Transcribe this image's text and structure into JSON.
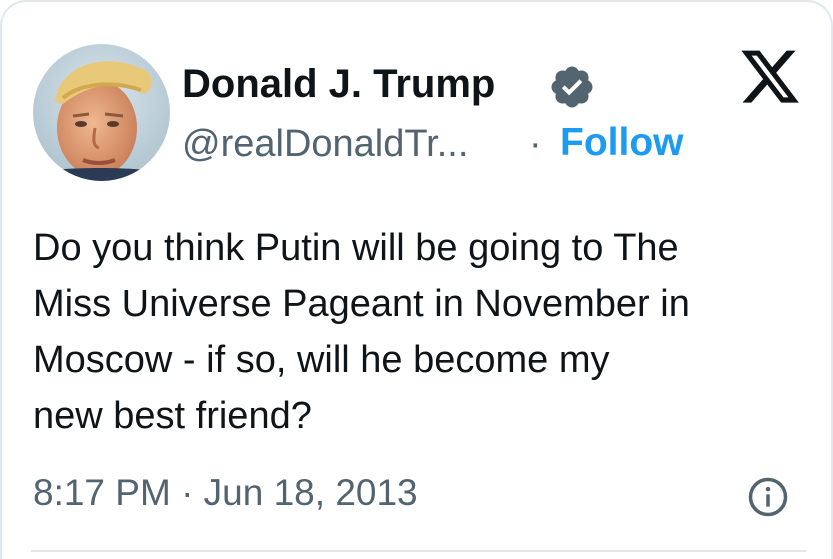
{
  "author": {
    "display_name": "Donald J. Trump",
    "handle": "@realDonaldTr...",
    "verified_icon": "verified-badge-icon",
    "verified_color": "#536471"
  },
  "header": {
    "separator": "·",
    "follow_label": "Follow",
    "brand_icon": "x-logo-icon"
  },
  "tweet": {
    "text": "Do you think Putin will be going to The\nMiss Universe Pageant in November in\nMoscow - if so, will he become my\nnew best friend?"
  },
  "footer": {
    "timestamp": "8:17 PM · Jun 18, 2013",
    "info_icon": "info-icon"
  },
  "colors": {
    "text": "#0f1419",
    "secondary": "#536471",
    "accent": "#1d9bf0",
    "border": "#e1e8ed"
  }
}
